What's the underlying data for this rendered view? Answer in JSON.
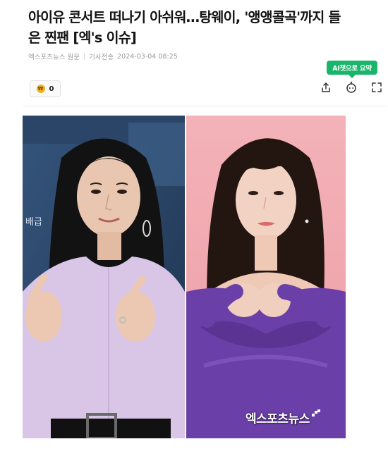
{
  "article": {
    "headline_line1": "아이유 콘서트 떠나기 아쉬워…탕웨이, '앵앵콜곡'까지 들",
    "headline_line2": "은 찐팬 [엑's 이슈]",
    "source": "엑스포츠뉴스 원문",
    "transmit_label": "기사전송",
    "timestamp": "2024-03-04 08:25"
  },
  "ai_summary": {
    "label": "AI챗으로 요약"
  },
  "reaction": {
    "count": "0",
    "icon": "coin-icon"
  },
  "toolbar": {
    "icons": [
      "share-icon",
      "chatbot-icon",
      "expand-icon"
    ]
  },
  "photos": {
    "watermark": "엑스포츠뉴스",
    "backdrop_text": "배급",
    "colors": {
      "left_backdrop": "#2c4a6e",
      "left_blouse": "#d9c6e6",
      "right_backdrop": "#f0a8b0",
      "right_sweater": "#6b3fa8"
    }
  },
  "colors": {
    "ai_badge": "#19b56a",
    "headline": "#121212",
    "meta": "#9a9a9a"
  }
}
